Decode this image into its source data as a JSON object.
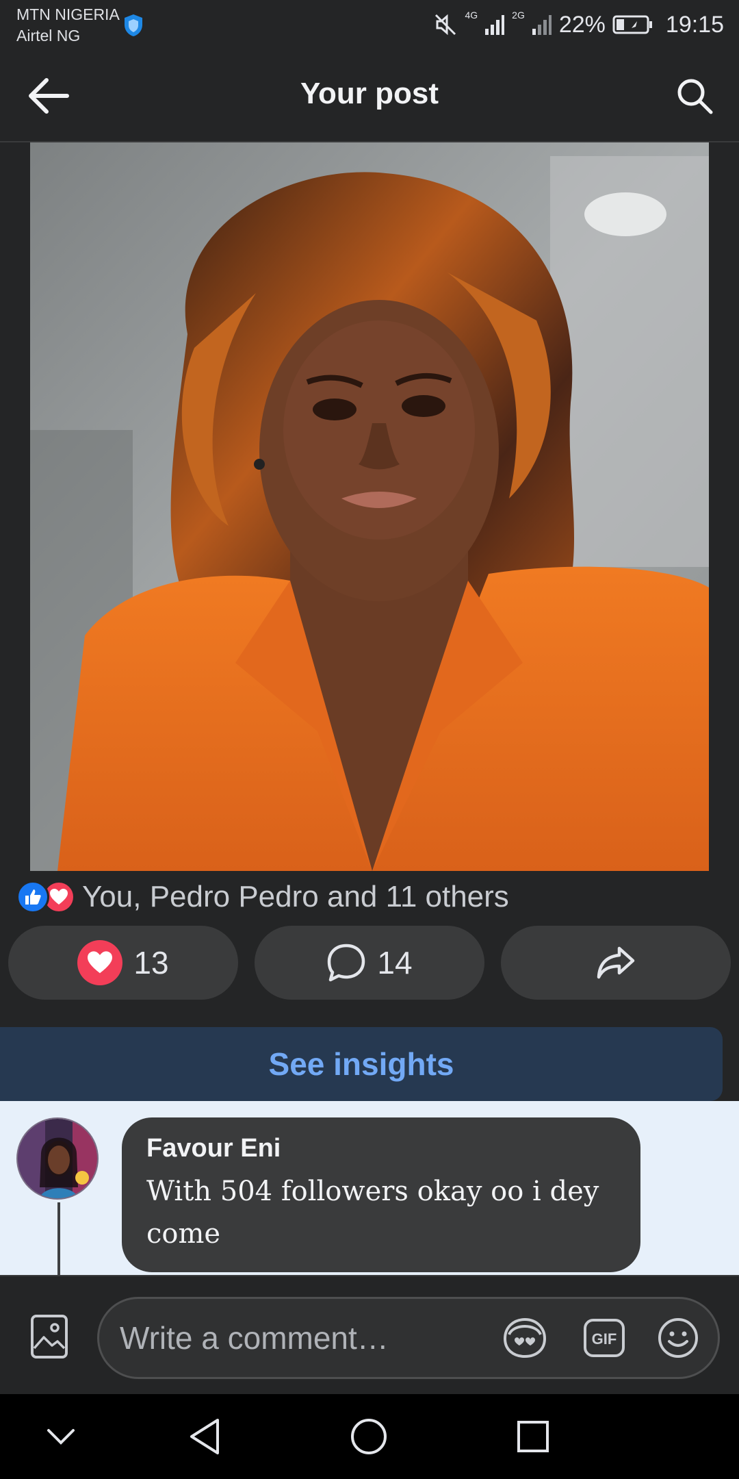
{
  "status_bar": {
    "carrier_primary": "MTN NIGERIA",
    "carrier_secondary": "Airtel NG",
    "network_1": "4G",
    "network_2": "2G",
    "battery_percent": "22%",
    "time": "19:15",
    "icons": [
      "shield-icon",
      "mute-icon",
      "signal-icon",
      "battery-icon"
    ]
  },
  "header": {
    "title": "Your post",
    "back_icon": "arrow-left-icon",
    "search_icon": "search-icon"
  },
  "post": {
    "image_icon": "portrait-photo",
    "reactions_summary": "You, Pedro Pedro and 11 others",
    "reaction_types": [
      "like",
      "love"
    ]
  },
  "actions": {
    "reactions_count": "13",
    "comments_count": "14",
    "share_icon": "share-icon"
  },
  "insights": {
    "label": "See insights"
  },
  "comment": {
    "author": "Favour Eni",
    "text": "With 504 followers okay oo i dey come"
  },
  "composer": {
    "placeholder": "Write a comment…",
    "gif_label": "GIF"
  },
  "colors": {
    "background": "#242526",
    "pill": "#3a3b3c",
    "accent_blue": "#72a9f5",
    "insights_bg": "#263951",
    "like_blue": "#1877f2",
    "love_red": "#f33e58",
    "comment_bg": "#e7f0fa"
  }
}
